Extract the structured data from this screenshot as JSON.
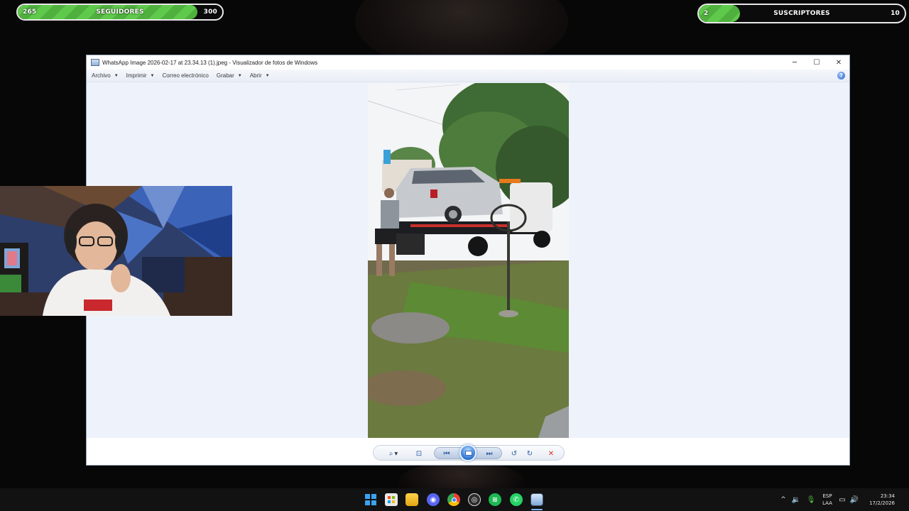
{
  "overlay": {
    "followers": {
      "current": "265",
      "label": "SEGUIDORES",
      "goal": "300",
      "progress": 0.88
    },
    "subscribers": {
      "current": "2",
      "label": "SUSCRIPTORES",
      "goal": "10",
      "progress": 0.2
    }
  },
  "window": {
    "title": "WhatsApp Image 2026-02-17 at 23.34.13 (1).jpeg - Visualizador de fotos de Windows",
    "controls": {
      "minimize": "─",
      "maximize": "☐",
      "close": "✕"
    }
  },
  "menu": {
    "items": [
      {
        "label": "Archivo",
        "has_caret": true
      },
      {
        "label": "Imprimir",
        "has_caret": true
      },
      {
        "label": "Correo electrónico",
        "has_caret": false
      },
      {
        "label": "Grabar",
        "has_caret": true
      },
      {
        "label": "Abrir",
        "has_caret": true
      }
    ],
    "help": "?"
  },
  "toolbar": {
    "zoom": "⌕",
    "fit": "⊡",
    "previous": "⏮",
    "next": "⏭",
    "rotate_left": "↺",
    "rotate_right": "↻",
    "delete": "✕"
  },
  "taskbar": {
    "icons": [
      "windows-start-icon",
      "store-icon",
      "file-explorer-icon",
      "discord-icon",
      "chrome-icon",
      "obs-icon",
      "spotify-icon",
      "whatsapp-icon",
      "photo-viewer-icon"
    ],
    "tray": {
      "chevron": "^",
      "lang_top": "ESP",
      "lang_bottom": "LAA",
      "time": "23:34",
      "date": "17/2/2026"
    }
  },
  "colors": {
    "accent_green": "#5fc94b",
    "delete_red": "#d9332b",
    "viewer_bg": "#eef2fb"
  }
}
